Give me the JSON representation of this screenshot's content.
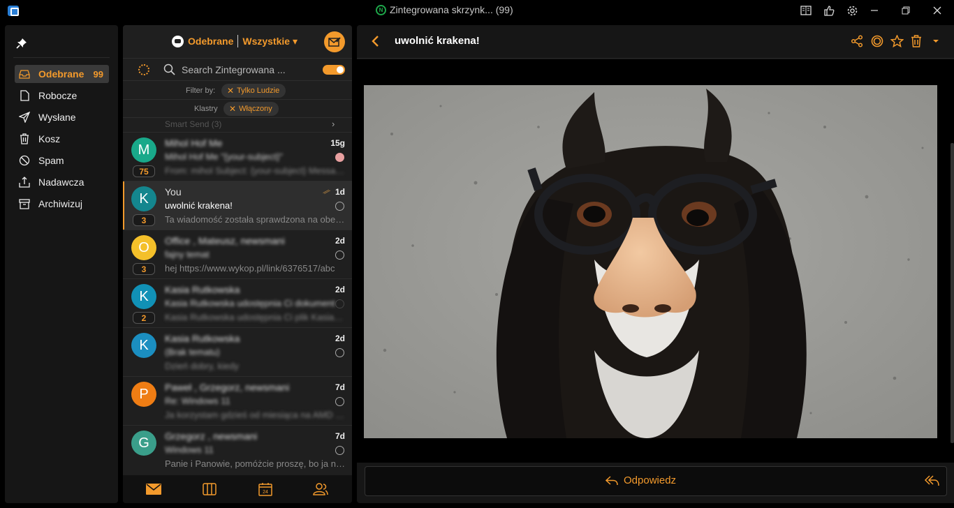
{
  "window": {
    "title": "Zintegrowana skrzynk... (99)",
    "title_icon_glyph": "N"
  },
  "sidebar": {
    "items": [
      {
        "label": "Odebrane",
        "count": "99",
        "icon": "inbox-icon",
        "active": true
      },
      {
        "label": "Robocze",
        "icon": "draft-icon"
      },
      {
        "label": "Wysłane",
        "icon": "send-icon"
      },
      {
        "label": "Kosz",
        "icon": "trash-icon"
      },
      {
        "label": "Spam",
        "icon": "spam-icon"
      },
      {
        "label": "Nadawcza",
        "icon": "outbox-icon"
      },
      {
        "label": "Archiwizuj",
        "icon": "archive-icon"
      }
    ]
  },
  "list": {
    "folder": "Odebrane",
    "filter": "Wszystkie ▾",
    "search_placeholder": "Search Zintegrowana ...",
    "filter_by_label": "Filter by:",
    "filter_chip": "Tylko Ludzie",
    "clusters_label": "Klastry",
    "clusters_chip": "Włączony",
    "smart_send": "Smart Send (3)",
    "messages": [
      {
        "sender": "Mihol Hof Me",
        "subject": "Mihol Hof Me \"{your-subject}\"",
        "preview": "From: mihol Subject: {your-subject} Message",
        "date": "15g",
        "count": "75",
        "initial": "M",
        "color": "#19a98a",
        "blurred": true,
        "dot": "pink"
      },
      {
        "sender": "You",
        "subject": "uwolnić krakena!",
        "preview": "Ta wiadomość została sprawdzona na obecność wirusów",
        "date": "1d",
        "count": "3",
        "initial": "K",
        "color": "#14868e",
        "blurred": false,
        "selected": true,
        "attachment": true
      },
      {
        "sender": "Office , Mateusz, newsmani",
        "subject": "fajny temat",
        "preview": "hej https://www.wykop.pl/link/6376517/abc",
        "date": "2d",
        "count": "3",
        "initial": "O",
        "color": "#f4c02a",
        "blurred": true,
        "preview_clear": true
      },
      {
        "sender": "Kasia Rutkowska",
        "subject": "Kasia Rutkowska udostępnia Ci dokument",
        "preview": "Kasia Rutkowska udostępnia Ci plik Kasia Rutkowska",
        "date": "2d",
        "count": "2",
        "initial": "K",
        "color": "#1191b6",
        "blurred": true
      },
      {
        "sender": "Kasia Rutkowska",
        "subject": "(Brak tematu)",
        "preview": "Dzień dobry, kiedy",
        "date": "2d",
        "count": "",
        "initial": "K",
        "color": "#1b8ec0",
        "blurred": true
      },
      {
        "sender": "Paweł , Grzegorz, newsmani",
        "subject": "Re: Windows 11",
        "preview": "Ja korzystam gdzieś od miesiąca na AMD Ryzen",
        "date": "7d",
        "count": "",
        "initial": "P",
        "color": "#ef7d14",
        "blurred": true
      },
      {
        "sender": "Grzegorz , newsmani",
        "subject": "Windows 11",
        "preview": "Panie i Panowie, pomóżcie proszę, bo ja nie wiem",
        "date": "7d",
        "count": "",
        "initial": "G",
        "color": "#3a9e8a",
        "blurred": true,
        "preview_clear": true
      }
    ]
  },
  "reader": {
    "subject": "uwolnić krakena!",
    "reply_label": "Odpowiedz"
  },
  "colors": {
    "accent": "#f39a2c",
    "panel": "#1f1f1f",
    "background": "#000000"
  }
}
